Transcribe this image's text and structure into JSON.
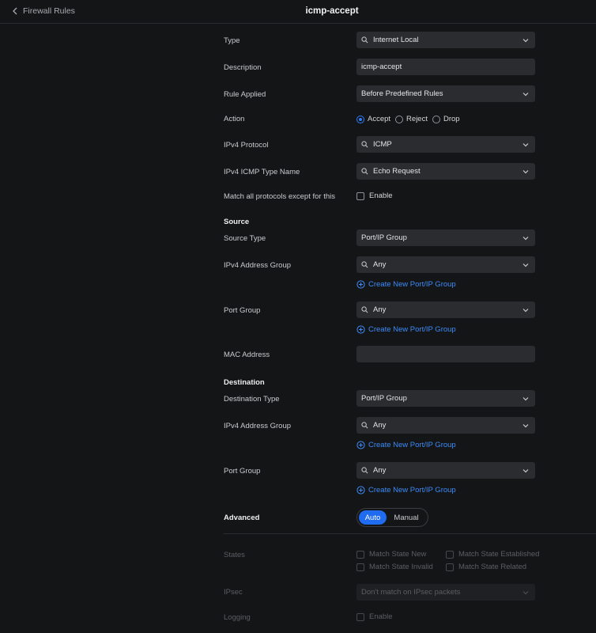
{
  "header": {
    "back_label": "Firewall Rules",
    "title": "icmp-accept"
  },
  "form": {
    "type": {
      "label": "Type",
      "value": "Internet Local"
    },
    "description": {
      "label": "Description",
      "value": "icmp-accept"
    },
    "rule_applied": {
      "label": "Rule Applied",
      "value": "Before Predefined Rules"
    },
    "action": {
      "label": "Action",
      "options": [
        "Accept",
        "Reject",
        "Drop"
      ],
      "selected": "Accept"
    },
    "ipv4_protocol": {
      "label": "IPv4 Protocol",
      "value": "ICMP"
    },
    "ipv4_icmp_type": {
      "label": "IPv4 ICMP Type Name",
      "value": "Echo Request"
    },
    "match_all": {
      "label": "Match all protocols except for this",
      "checkbox_label": "Enable",
      "checked": false
    }
  },
  "source": {
    "heading": "Source",
    "source_type": {
      "label": "Source Type",
      "value": "Port/IP Group"
    },
    "ipv4_address_group": {
      "label": "IPv4 Address Group",
      "value": "Any",
      "create_link": "Create New Port/IP Group"
    },
    "port_group": {
      "label": "Port Group",
      "value": "Any",
      "create_link": "Create New Port/IP Group"
    },
    "mac_address": {
      "label": "MAC Address",
      "value": ""
    }
  },
  "destination": {
    "heading": "Destination",
    "destination_type": {
      "label": "Destination Type",
      "value": "Port/IP Group"
    },
    "ipv4_address_group": {
      "label": "IPv4 Address Group",
      "value": "Any",
      "create_link": "Create New Port/IP Group"
    },
    "port_group": {
      "label": "Port Group",
      "value": "Any",
      "create_link": "Create New Port/IP Group"
    }
  },
  "advanced": {
    "heading": "Advanced",
    "modes": [
      "Auto",
      "Manual"
    ],
    "selected_mode": "Auto",
    "states": {
      "label": "States",
      "options": [
        "Match State New",
        "Match State Established",
        "Match State Invalid",
        "Match State Related"
      ]
    },
    "ipsec": {
      "label": "IPsec",
      "value": "Don't match on IPsec packets"
    },
    "logging": {
      "label": "Logging",
      "checkbox_label": "Enable"
    }
  },
  "colors": {
    "background": "#141517",
    "field": "#2a2c30",
    "accent": "#2f7cf6",
    "link": "#3d8bf7"
  }
}
